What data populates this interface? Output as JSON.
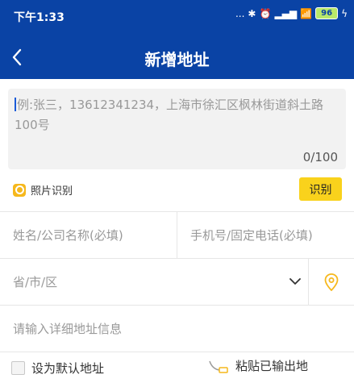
{
  "status": {
    "time": "下午1:33",
    "icons_text": "...",
    "battery": "96"
  },
  "header": {
    "title": "新增地址",
    "back_icon": "chevron-left-icon"
  },
  "paste": {
    "placeholder": "例:张三，13612341234，上海市徐汇区枫林街道斜土路100号",
    "counter": "0/100"
  },
  "photo": {
    "label": "照片识别",
    "recognize_label": "识别"
  },
  "form": {
    "name_placeholder": "姓名/公司名称(必填)",
    "phone_placeholder": "手机号/固定电话(必填)",
    "region_placeholder": "省/市/区",
    "detail_placeholder": "请输入详细地址信息"
  },
  "footer": {
    "default_label": "设为默认地址",
    "clipboard_label": "粘贴已输出地"
  },
  "colors": {
    "brand": "#0a43a5",
    "accent": "#f9d21c"
  }
}
